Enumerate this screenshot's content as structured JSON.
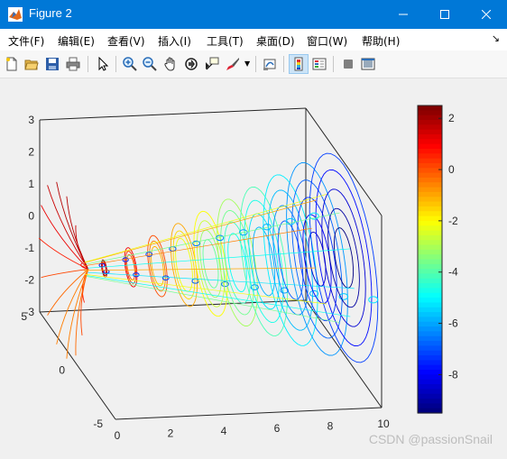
{
  "window": {
    "title": "Figure 2"
  },
  "menu": [
    {
      "label": "文件(F)"
    },
    {
      "label": "编辑(E)"
    },
    {
      "label": "查看(V)"
    },
    {
      "label": "插入(I)"
    },
    {
      "label": "工具(T)"
    },
    {
      "label": "桌面(D)"
    },
    {
      "label": "窗口(W)"
    },
    {
      "label": "帮助(H)"
    }
  ],
  "menu_overflow": "↘",
  "toolbar": {
    "icons": [
      "new-figure-icon",
      "open-file-icon",
      "save-icon",
      "print-icon",
      "pointer-icon",
      "zoom-in-icon",
      "zoom-out-icon",
      "pan-icon",
      "rotate-3d-icon",
      "data-cursor-icon",
      "brush-icon",
      "link-plot-icon",
      "colorbar-icon",
      "legend-icon",
      "hide-plot-tools-icon",
      "show-plot-tools-icon"
    ]
  },
  "chart_data": {
    "type": "contour3d",
    "xlabel": "",
    "ylabel": "",
    "zlabel": "",
    "xlim": [
      0,
      10
    ],
    "ylim": [
      -5,
      5
    ],
    "zlim": [
      -3,
      3
    ],
    "xticks": [
      "0",
      "2",
      "4",
      "6",
      "8",
      "10"
    ],
    "yticks": [
      "-5",
      "0",
      "5"
    ],
    "zticks": [
      "3",
      "2",
      "1",
      "0",
      "-1",
      "-2",
      "-3"
    ],
    "colorbar": {
      "colormap": "jet",
      "range": [
        -9.5,
        2.5
      ],
      "ticks": [
        "2",
        "0",
        "-2",
        "-4",
        "-6",
        "-8"
      ]
    },
    "slices_x": [
      1,
      2,
      3,
      4,
      5,
      6,
      7,
      8,
      9,
      10
    ]
  },
  "watermark": "CSDN @passionSnail"
}
